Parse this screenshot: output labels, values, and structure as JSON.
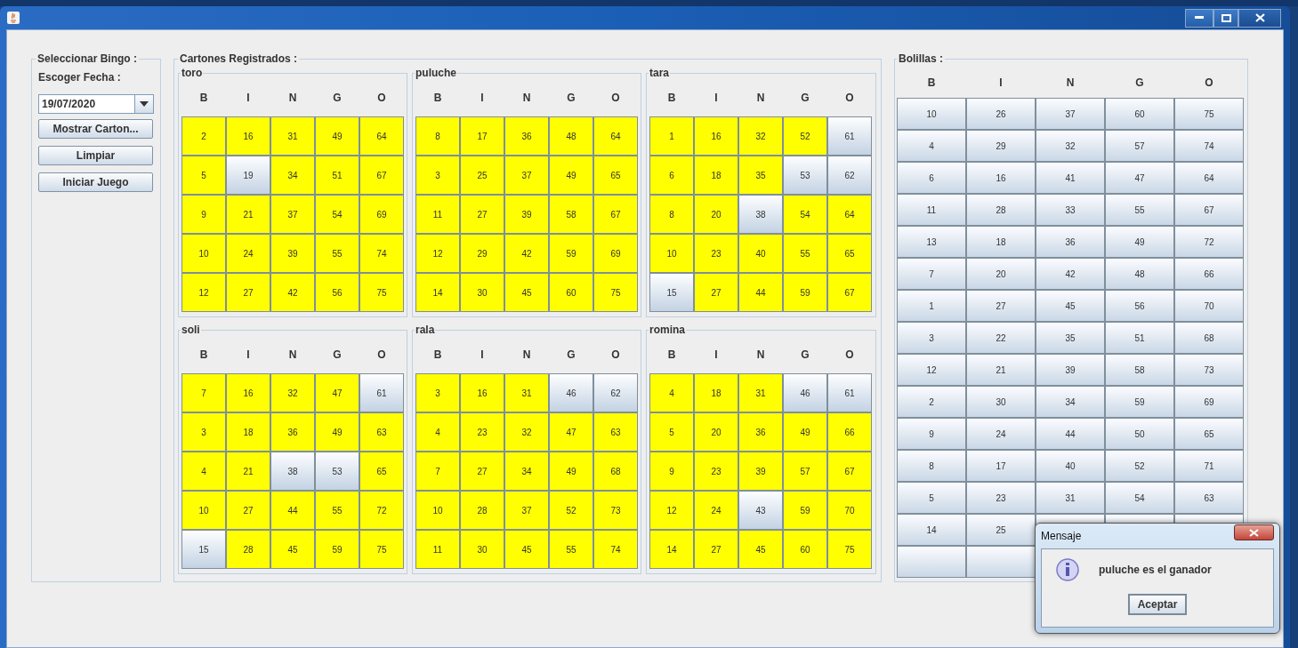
{
  "left_panel": {
    "title": "Seleccionar Bingo :",
    "date_label": "Escoger Fecha :",
    "date_value": "19/07/2020",
    "buttons": [
      "Mostrar Carton...",
      "Limpiar",
      "Iniciar Juego"
    ]
  },
  "cards_panel": {
    "title": "Cartones Registrados :",
    "cards": [
      {
        "name": "toro",
        "columns": [
          "B",
          "I",
          "N",
          "G",
          "O"
        ],
        "rows": [
          [
            {
              "n": "2",
              "marked": true
            },
            {
              "n": "16",
              "marked": true
            },
            {
              "n": "31",
              "marked": true
            },
            {
              "n": "49",
              "marked": true
            },
            {
              "n": "64",
              "marked": true
            }
          ],
          [
            {
              "n": "5",
              "marked": true
            },
            {
              "n": "19",
              "marked": false
            },
            {
              "n": "34",
              "marked": true
            },
            {
              "n": "51",
              "marked": true
            },
            {
              "n": "67",
              "marked": true
            }
          ],
          [
            {
              "n": "9",
              "marked": true
            },
            {
              "n": "21",
              "marked": true
            },
            {
              "n": "37",
              "marked": true
            },
            {
              "n": "54",
              "marked": true
            },
            {
              "n": "69",
              "marked": true
            }
          ],
          [
            {
              "n": "10",
              "marked": true
            },
            {
              "n": "24",
              "marked": true
            },
            {
              "n": "39",
              "marked": true
            },
            {
              "n": "55",
              "marked": true
            },
            {
              "n": "74",
              "marked": true
            }
          ],
          [
            {
              "n": "12",
              "marked": true
            },
            {
              "n": "27",
              "marked": true
            },
            {
              "n": "42",
              "marked": true
            },
            {
              "n": "56",
              "marked": true
            },
            {
              "n": "75",
              "marked": true
            }
          ]
        ]
      },
      {
        "name": "puluche",
        "columns": [
          "B",
          "I",
          "N",
          "G",
          "O"
        ],
        "rows": [
          [
            {
              "n": "8",
              "marked": true
            },
            {
              "n": "17",
              "marked": true
            },
            {
              "n": "36",
              "marked": true
            },
            {
              "n": "48",
              "marked": true
            },
            {
              "n": "64",
              "marked": true
            }
          ],
          [
            {
              "n": "3",
              "marked": true
            },
            {
              "n": "25",
              "marked": true
            },
            {
              "n": "37",
              "marked": true
            },
            {
              "n": "49",
              "marked": true
            },
            {
              "n": "65",
              "marked": true
            }
          ],
          [
            {
              "n": "11",
              "marked": true
            },
            {
              "n": "27",
              "marked": true
            },
            {
              "n": "39",
              "marked": true
            },
            {
              "n": "58",
              "marked": true
            },
            {
              "n": "67",
              "marked": true
            }
          ],
          [
            {
              "n": "12",
              "marked": true
            },
            {
              "n": "29",
              "marked": true
            },
            {
              "n": "42",
              "marked": true
            },
            {
              "n": "59",
              "marked": true
            },
            {
              "n": "69",
              "marked": true
            }
          ],
          [
            {
              "n": "14",
              "marked": true
            },
            {
              "n": "30",
              "marked": true
            },
            {
              "n": "45",
              "marked": true
            },
            {
              "n": "60",
              "marked": true
            },
            {
              "n": "75",
              "marked": true
            }
          ]
        ]
      },
      {
        "name": "tara",
        "columns": [
          "B",
          "I",
          "N",
          "G",
          "O"
        ],
        "rows": [
          [
            {
              "n": "1",
              "marked": true
            },
            {
              "n": "16",
              "marked": true
            },
            {
              "n": "32",
              "marked": true
            },
            {
              "n": "52",
              "marked": true
            },
            {
              "n": "61",
              "marked": false
            }
          ],
          [
            {
              "n": "6",
              "marked": true
            },
            {
              "n": "18",
              "marked": true
            },
            {
              "n": "35",
              "marked": true
            },
            {
              "n": "53",
              "marked": false
            },
            {
              "n": "62",
              "marked": false
            }
          ],
          [
            {
              "n": "8",
              "marked": true
            },
            {
              "n": "20",
              "marked": true
            },
            {
              "n": "38",
              "marked": false
            },
            {
              "n": "54",
              "marked": true
            },
            {
              "n": "64",
              "marked": true
            }
          ],
          [
            {
              "n": "10",
              "marked": true
            },
            {
              "n": "23",
              "marked": true
            },
            {
              "n": "40",
              "marked": true
            },
            {
              "n": "55",
              "marked": true
            },
            {
              "n": "65",
              "marked": true
            }
          ],
          [
            {
              "n": "15",
              "marked": false
            },
            {
              "n": "27",
              "marked": true
            },
            {
              "n": "44",
              "marked": true
            },
            {
              "n": "59",
              "marked": true
            },
            {
              "n": "67",
              "marked": true
            }
          ]
        ]
      },
      {
        "name": "soli",
        "columns": [
          "B",
          "I",
          "N",
          "G",
          "O"
        ],
        "rows": [
          [
            {
              "n": "7",
              "marked": true
            },
            {
              "n": "16",
              "marked": true
            },
            {
              "n": "32",
              "marked": true
            },
            {
              "n": "47",
              "marked": true
            },
            {
              "n": "61",
              "marked": false
            }
          ],
          [
            {
              "n": "3",
              "marked": true
            },
            {
              "n": "18",
              "marked": true
            },
            {
              "n": "36",
              "marked": true
            },
            {
              "n": "49",
              "marked": true
            },
            {
              "n": "63",
              "marked": true
            }
          ],
          [
            {
              "n": "4",
              "marked": true
            },
            {
              "n": "21",
              "marked": true
            },
            {
              "n": "38",
              "marked": false
            },
            {
              "n": "53",
              "marked": false
            },
            {
              "n": "65",
              "marked": true
            }
          ],
          [
            {
              "n": "10",
              "marked": true
            },
            {
              "n": "27",
              "marked": true
            },
            {
              "n": "44",
              "marked": true
            },
            {
              "n": "55",
              "marked": true
            },
            {
              "n": "72",
              "marked": true
            }
          ],
          [
            {
              "n": "15",
              "marked": false
            },
            {
              "n": "28",
              "marked": true
            },
            {
              "n": "45",
              "marked": true
            },
            {
              "n": "59",
              "marked": true
            },
            {
              "n": "75",
              "marked": true
            }
          ]
        ]
      },
      {
        "name": "rala",
        "columns": [
          "B",
          "I",
          "N",
          "G",
          "O"
        ],
        "rows": [
          [
            {
              "n": "3",
              "marked": true
            },
            {
              "n": "16",
              "marked": true
            },
            {
              "n": "31",
              "marked": true
            },
            {
              "n": "46",
              "marked": false
            },
            {
              "n": "62",
              "marked": false
            }
          ],
          [
            {
              "n": "4",
              "marked": true
            },
            {
              "n": "23",
              "marked": true
            },
            {
              "n": "32",
              "marked": true
            },
            {
              "n": "47",
              "marked": true
            },
            {
              "n": "63",
              "marked": true
            }
          ],
          [
            {
              "n": "7",
              "marked": true
            },
            {
              "n": "27",
              "marked": true
            },
            {
              "n": "34",
              "marked": true
            },
            {
              "n": "49",
              "marked": true
            },
            {
              "n": "68",
              "marked": true
            }
          ],
          [
            {
              "n": "10",
              "marked": true
            },
            {
              "n": "28",
              "marked": true
            },
            {
              "n": "37",
              "marked": true
            },
            {
              "n": "52",
              "marked": true
            },
            {
              "n": "73",
              "marked": true
            }
          ],
          [
            {
              "n": "11",
              "marked": true
            },
            {
              "n": "30",
              "marked": true
            },
            {
              "n": "45",
              "marked": true
            },
            {
              "n": "55",
              "marked": true
            },
            {
              "n": "74",
              "marked": true
            }
          ]
        ]
      },
      {
        "name": "romina",
        "columns": [
          "B",
          "I",
          "N",
          "G",
          "O"
        ],
        "rows": [
          [
            {
              "n": "4",
              "marked": true
            },
            {
              "n": "18",
              "marked": true
            },
            {
              "n": "31",
              "marked": true
            },
            {
              "n": "46",
              "marked": false
            },
            {
              "n": "61",
              "marked": false
            }
          ],
          [
            {
              "n": "5",
              "marked": true
            },
            {
              "n": "20",
              "marked": true
            },
            {
              "n": "36",
              "marked": true
            },
            {
              "n": "49",
              "marked": true
            },
            {
              "n": "66",
              "marked": true
            }
          ],
          [
            {
              "n": "9",
              "marked": true
            },
            {
              "n": "23",
              "marked": true
            },
            {
              "n": "39",
              "marked": true
            },
            {
              "n": "57",
              "marked": true
            },
            {
              "n": "67",
              "marked": true
            }
          ],
          [
            {
              "n": "12",
              "marked": true
            },
            {
              "n": "24",
              "marked": true
            },
            {
              "n": "43",
              "marked": false
            },
            {
              "n": "59",
              "marked": true
            },
            {
              "n": "70",
              "marked": true
            }
          ],
          [
            {
              "n": "14",
              "marked": true
            },
            {
              "n": "27",
              "marked": true
            },
            {
              "n": "45",
              "marked": true
            },
            {
              "n": "60",
              "marked": true
            },
            {
              "n": "75",
              "marked": true
            }
          ]
        ]
      }
    ]
  },
  "balls_panel": {
    "title": "Bolillas :",
    "columns": [
      "B",
      "I",
      "N",
      "G",
      "O"
    ],
    "rows": [
      [
        "10",
        "26",
        "37",
        "60",
        "75"
      ],
      [
        "4",
        "29",
        "32",
        "57",
        "74"
      ],
      [
        "6",
        "16",
        "41",
        "47",
        "64"
      ],
      [
        "11",
        "28",
        "33",
        "55",
        "67"
      ],
      [
        "13",
        "18",
        "36",
        "49",
        "72"
      ],
      [
        "7",
        "20",
        "42",
        "48",
        "66"
      ],
      [
        "1",
        "27",
        "45",
        "56",
        "70"
      ],
      [
        "3",
        "22",
        "35",
        "51",
        "68"
      ],
      [
        "12",
        "21",
        "39",
        "58",
        "73"
      ],
      [
        "2",
        "30",
        "34",
        "59",
        "69"
      ],
      [
        "9",
        "24",
        "44",
        "50",
        "65"
      ],
      [
        "8",
        "17",
        "40",
        "52",
        "71"
      ],
      [
        "5",
        "23",
        "31",
        "54",
        "63"
      ],
      [
        "14",
        "25"
      ],
      []
    ]
  },
  "dialog": {
    "title": "Mensaje",
    "message": "puluche es el ganador",
    "button": "Aceptar"
  }
}
